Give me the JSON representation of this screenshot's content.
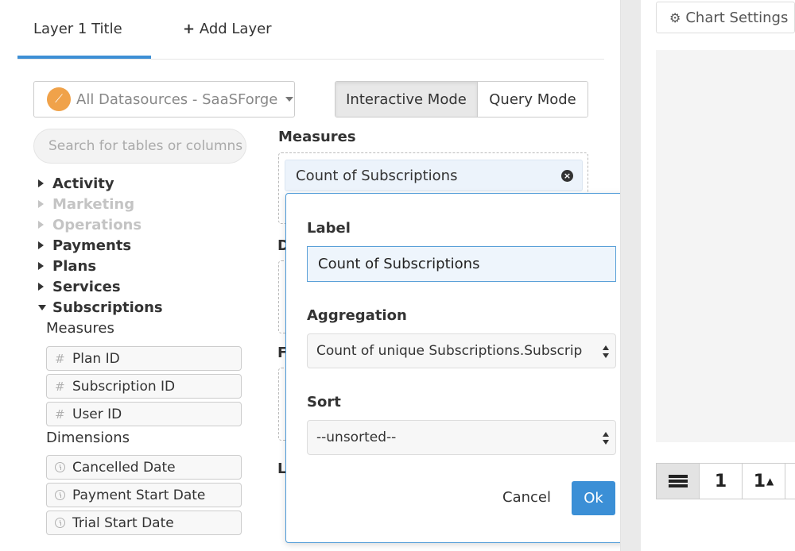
{
  "tabs": {
    "active": "Layer 1 Title",
    "add": "Add Layer"
  },
  "datasource": {
    "label": "All Datasources - SaaSForge"
  },
  "modes": {
    "interactive": "Interactive Mode",
    "query": "Query Mode"
  },
  "search": {
    "placeholder": "Search for tables or columns"
  },
  "tree": {
    "items": [
      {
        "label": "Activity"
      },
      {
        "label": "Marketing"
      },
      {
        "label": "Operations"
      },
      {
        "label": "Payments"
      },
      {
        "label": "Plans"
      },
      {
        "label": "Services"
      },
      {
        "label": "Subscriptions"
      }
    ],
    "measures_heading": "Measures",
    "measures": [
      "Plan ID",
      "Subscription ID",
      "User ID"
    ],
    "dimensions_heading": "Dimensions",
    "dimensions": [
      "Cancelled Date",
      "Payment Start Date",
      "Trial Start Date"
    ]
  },
  "query": {
    "measures_heading": "Measures",
    "measure_chip": "Count of Subscriptions",
    "letters": [
      "D",
      "F",
      "L"
    ]
  },
  "popover": {
    "label_heading": "Label",
    "label_value": "Count of Subscriptions",
    "aggregation_heading": "Aggregation",
    "aggregation_value": "Count of unique Subscriptions.Subscrip",
    "sort_heading": "Sort",
    "sort_value": "--unsorted--",
    "cancel": "Cancel",
    "ok": "Ok"
  },
  "right_panel": {
    "chart_settings": "Chart Settings",
    "viz_buttons": [
      "1",
      "1"
    ]
  },
  "colors": {
    "accent": "#3b8fd6",
    "datasource_logo": "#f0a24a"
  }
}
